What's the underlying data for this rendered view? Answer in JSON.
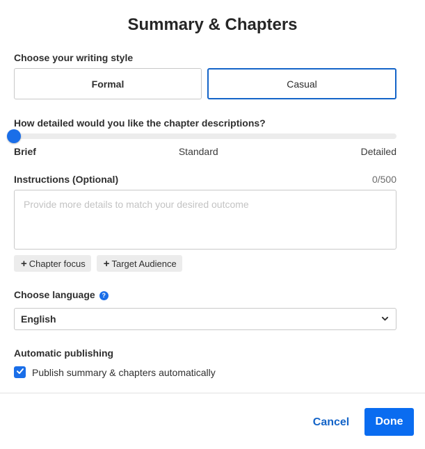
{
  "dialog": {
    "title": "Summary & Chapters"
  },
  "writing_style": {
    "label": "Choose your writing style",
    "options": [
      "Formal",
      "Casual"
    ],
    "selected": "Casual"
  },
  "detail": {
    "label": "How detailed would you like the chapter descriptions?",
    "levels": [
      "Brief",
      "Standard",
      "Detailed"
    ],
    "selected": "Brief",
    "value_fraction": 0
  },
  "instructions": {
    "label": "Instructions (Optional)",
    "counter": "0/500",
    "value": "",
    "placeholder": "Provide more details to match your desired outcome"
  },
  "chips": [
    {
      "label": "Chapter focus"
    },
    {
      "label": "Target Audience"
    }
  ],
  "language": {
    "label": "Choose language",
    "help_glyph": "?",
    "selected": "English"
  },
  "publishing": {
    "label": "Automatic publishing",
    "checkbox_label": "Publish summary & chapters automatically",
    "checked": true
  },
  "footer": {
    "cancel_label": "Cancel",
    "done_label": "Done"
  },
  "colors": {
    "accent": "#1a6ee8",
    "primary_button": "#0a6cf0",
    "link": "#1464c8"
  },
  "icons": {
    "dropdown": "chevron-down-icon",
    "checkbox": "checkmark-icon",
    "help": "question-icon",
    "chip": "plus-icon"
  }
}
